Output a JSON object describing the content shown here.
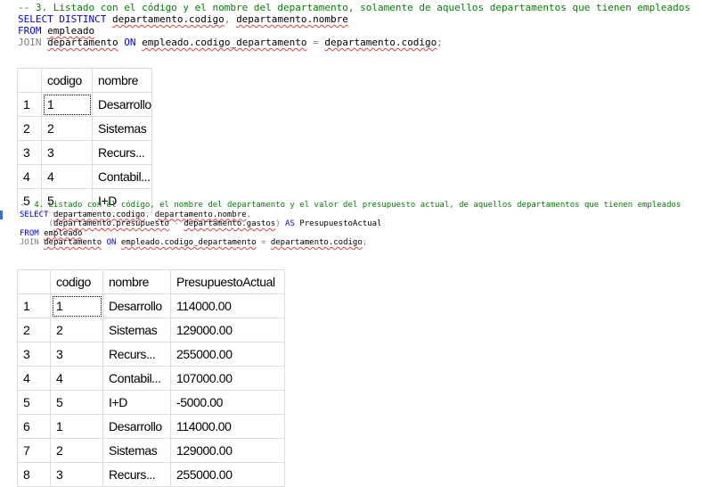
{
  "query1": {
    "comment": "-- 3. Listado con el código y el nombre del departamento, solamente de aquellos departamentos que tienen empleados",
    "line2_kw": "SELECT DISTINCT",
    "line2_a": "departamento.codigo",
    "line2_sep": ",",
    "line2_b": "departamento.nombre",
    "line3_kw": "FROM",
    "line3_a": "empleado",
    "line4_kw": "JOIN",
    "line4_a": "departamento",
    "line4_on": "ON",
    "line4_b": "empleado.codigo_departamento",
    "line4_eq": "=",
    "line4_c": "departamento.codigo",
    "line4_end": ";"
  },
  "result1": {
    "columns": [
      "codigo",
      "nombre"
    ],
    "rows": [
      [
        "1",
        "1",
        "Desarrollo"
      ],
      [
        "2",
        "2",
        "Sistemas"
      ],
      [
        "3",
        "3",
        "Recurs..."
      ],
      [
        "4",
        "4",
        "Contabil..."
      ],
      [
        "5",
        "5",
        "I+D"
      ]
    ]
  },
  "query2": {
    "comment": "-- 4. Listado con el código, el nombre del departamento y el valor del presupuesto actual, de aquellos departamentos que tienen empleados",
    "line2_kw": "SELECT",
    "line2_a": "departamento.codigo",
    "line2_sep": ",",
    "line2_b": "departamento.nombre",
    "line2_end": ",",
    "line3_open": "(",
    "line3_a": "departamento.presupuesto",
    "line3_minus": "-",
    "line3_b": "departamento.gastos",
    "line3_close": ")",
    "line3_as": "AS",
    "line3_alias": "PresupuestoActual",
    "line4_kw": "FROM",
    "line4_a": "empleado",
    "line5_kw": "JOIN",
    "line5_a": "departamento",
    "line5_on": "ON",
    "line5_b": "empleado.codigo_departamento",
    "line5_eq": "=",
    "line5_c": "departamento.codigo",
    "line5_end": ";"
  },
  "result2": {
    "columns": [
      "codigo",
      "nombre",
      "PresupuestoActual"
    ],
    "rows": [
      [
        "1",
        "1",
        "Desarrollo",
        "114000.00"
      ],
      [
        "2",
        "2",
        "Sistemas",
        "129000.00"
      ],
      [
        "3",
        "3",
        "Recurs...",
        "255000.00"
      ],
      [
        "4",
        "4",
        "Contabil...",
        "107000.00"
      ],
      [
        "5",
        "5",
        "I+D",
        "-5000.00"
      ],
      [
        "6",
        "1",
        "Desarrollo",
        "114000.00"
      ],
      [
        "7",
        "2",
        "Sistemas",
        "129000.00"
      ],
      [
        "8",
        "3",
        "Recurs...",
        "255000.00"
      ]
    ]
  },
  "colors": {
    "keyword": "#0000ff",
    "comment": "#008000",
    "operator": "#808080",
    "function": "#ff00ff",
    "grid_border": "#dcdcdc"
  }
}
